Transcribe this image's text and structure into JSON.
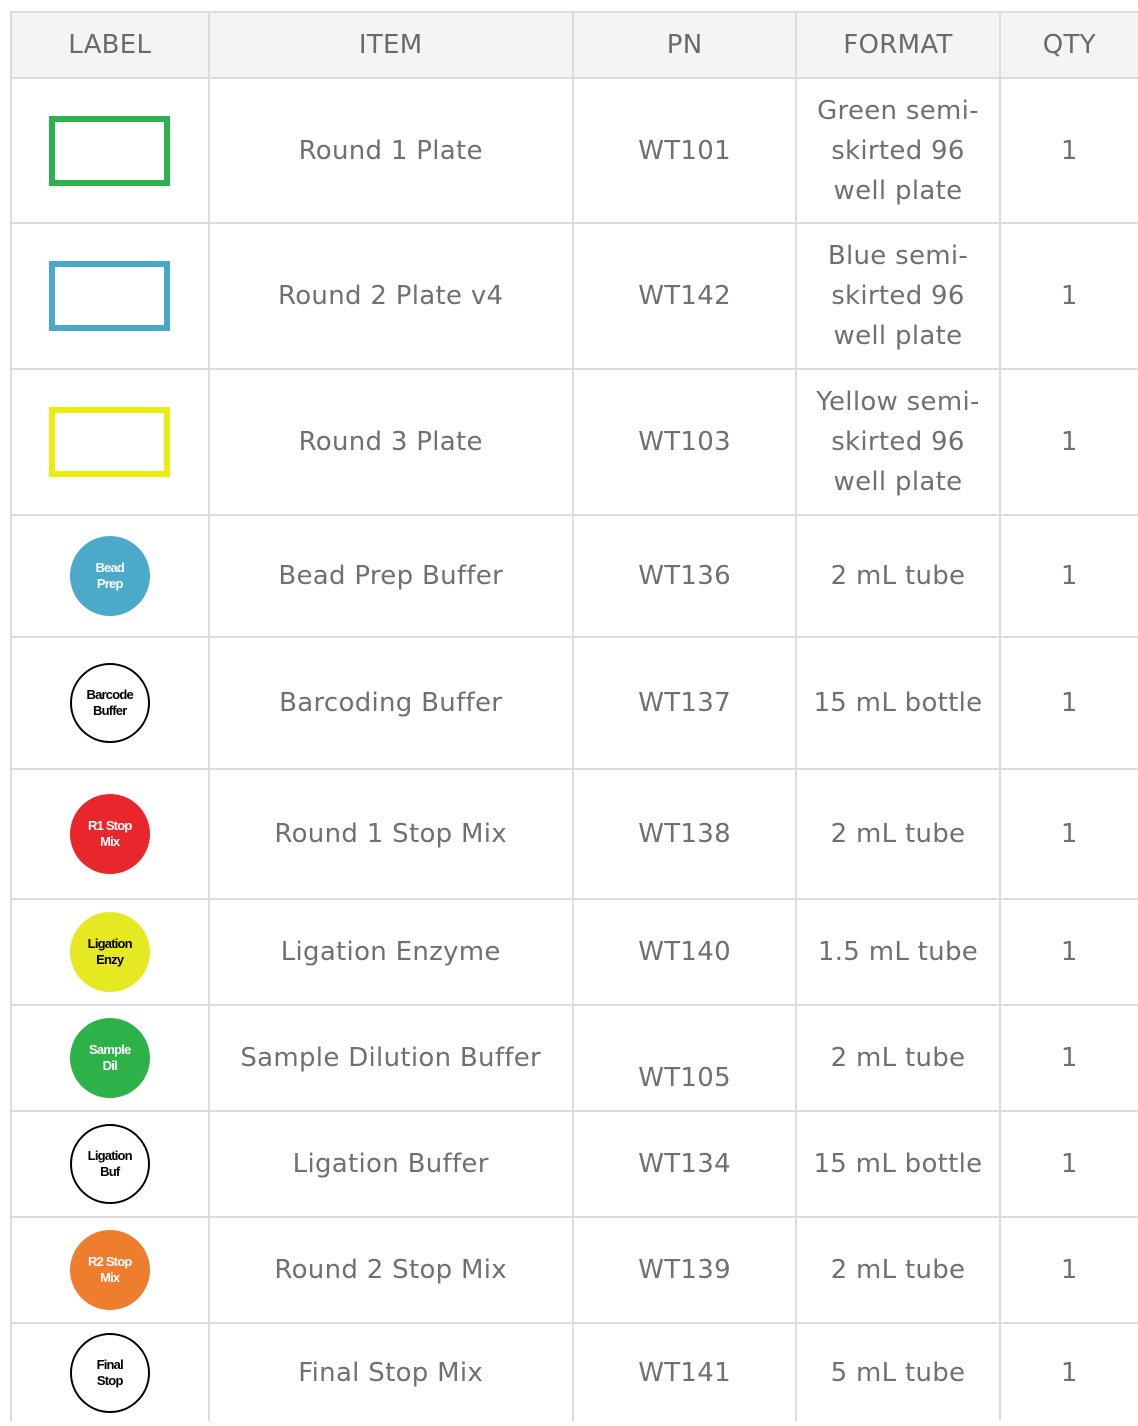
{
  "headers": {
    "label": "LABEL",
    "item": "ITEM",
    "pn": "PN",
    "format": "FORMAT",
    "qty": "QTY"
  },
  "rows": [
    {
      "label_type": "rect",
      "color": "#2bb24c",
      "item": "Round 1 Plate",
      "pn": "WT101",
      "format": "Green semi-skirted 96 well plate",
      "qty": "1"
    },
    {
      "label_type": "rect",
      "color": "#4aa8c9",
      "item": "Round 2 Plate v4",
      "pn": "WT142",
      "format": "Blue semi-skirted 96 well plate",
      "qty": "1"
    },
    {
      "label_type": "rect",
      "color": "#eaee10",
      "item": "Round 3 Plate",
      "pn": "WT103",
      "format": "Yellow semi-skirted 96 well plate",
      "qty": "1"
    },
    {
      "label_type": "circle",
      "color": "#4ba9c9",
      "text_color": "#ffffff",
      "label": "Bead\nPrep",
      "item": "Bead Prep Buffer",
      "pn": "WT136",
      "format": "2 mL tube",
      "qty": "1"
    },
    {
      "label_type": "circle",
      "color": "#ffffff",
      "text_color": "#000000",
      "label": "Barcode\nBuffer",
      "item": "Barcoding Buffer",
      "pn": "WT137",
      "format": "15 mL bottle",
      "qty": "1"
    },
    {
      "label_type": "circle",
      "color": "#e8262c",
      "text_color": "#ffffff",
      "label": "R1 Stop\nMix",
      "item": "Round 1 Stop Mix",
      "pn": "WT138",
      "format": "2 mL tube",
      "qty": "1"
    },
    {
      "label_type": "circle",
      "color": "#e6e922",
      "text_color": "#000000",
      "label": "Ligation\nEnzy",
      "item": "Ligation Enzyme",
      "pn": "WT140",
      "format": "1.5 mL tube",
      "qty": "1"
    },
    {
      "label_type": "circle",
      "color": "#2db24a",
      "text_color": "#ffffff",
      "label": "Sample\nDil",
      "item": "Sample Dilution Buffer",
      "pn": "WT105",
      "format": "2 mL tube",
      "qty": "1"
    },
    {
      "label_type": "circle",
      "color": "#ffffff",
      "text_color": "#000000",
      "label": "Ligation\nBuf",
      "item": "Ligation Buffer",
      "pn": "WT134",
      "format": "15 mL bottle",
      "qty": "1"
    },
    {
      "label_type": "circle",
      "color": "#ef7d2e",
      "text_color": "#ffffff",
      "label": "R2 Stop\nMix",
      "item": "Round 2 Stop Mix",
      "pn": "WT139",
      "format": "2 mL tube",
      "qty": "1"
    },
    {
      "label_type": "circle",
      "color": "#ffffff",
      "text_color": "#000000",
      "label": "Final\nStop",
      "item": "Final Stop Mix",
      "pn": "WT141",
      "format": "5 mL tube",
      "qty": "1"
    }
  ]
}
